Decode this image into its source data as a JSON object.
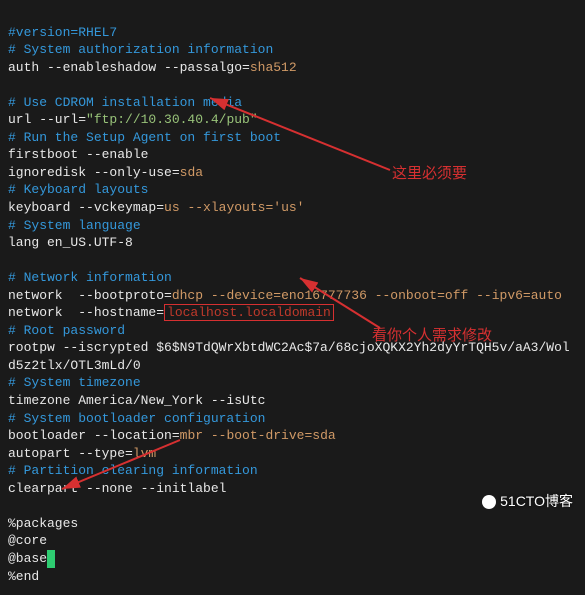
{
  "code": {
    "l1": "#version=RHEL7",
    "l2": "# System authorization information",
    "l3a": "auth --enableshadow --passalgo=",
    "l3b": "sha512",
    "l5": "# Use CDROM installation media",
    "l6a": "url --url=",
    "l6b": "\"ftp://10.30.40.4/pub\"",
    "l7": "# Run the Setup Agent on first boot",
    "l8": "firstboot --enable",
    "l9a": "ignoredisk --only-use=",
    "l9b": "sda",
    "l10": "# Keyboard layouts",
    "l11a": "keyboard --vckeymap=",
    "l11b": "us",
    "l11c": " --xlayouts=",
    "l11d": "'us'",
    "l12": "# System language",
    "l13": "lang en_US.UTF-8",
    "l15": "# Network information",
    "l16a": "network  --bootproto=",
    "l16b": "dhcp",
    "l16c": " --device=",
    "l16d": "eno16777736",
    "l16e": " --onboot=",
    "l16f": "off",
    "l16g": " --ipv6=",
    "l16h": "auto",
    "l17a": "network  --hostname=",
    "l17b": "localhost.localdomain",
    "l18": "# Root password",
    "l19": "rootpw --iscrypted $6$N9TdQWrXbtdWC2Ac$7a/68cjoXQKX2Yh2dyYrTQH5v/aA3/Wol",
    "l19b": "d5z2tlx/OTL3mLd/0",
    "l20": "# System timezone",
    "l21": "timezone America/New_York --isUtc",
    "l22": "# System bootloader configuration",
    "l23a": "bootloader --location=",
    "l23b": "mbr",
    "l23c": " --boot-drive=",
    "l23d": "sda",
    "l24a": "autopart --type=",
    "l24b": "lvm",
    "l25": "# Partition clearing information",
    "l26": "clearpart --none --initlabel",
    "l28": "%packages",
    "l29": "@core",
    "l30": "@base",
    "l31": "%end"
  },
  "anno": {
    "label1": "这里必须要",
    "label2": "看你个人需求修改"
  },
  "watermark": "51CTO博客",
  "colors": {
    "comment": "#3498db",
    "value": "#d19a66",
    "string": "#98c379",
    "error": "#d63031",
    "highlight": "#2ecc71"
  }
}
